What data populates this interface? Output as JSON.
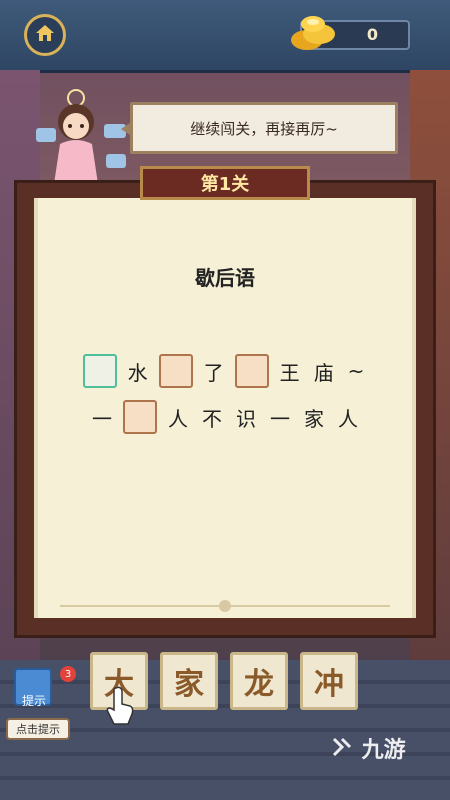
{
  "topbar": {
    "coin_count": "0",
    "home_icon": "home-icon",
    "coin_icon": "gold-ingot-icon"
  },
  "scene": {
    "speech_text": "继续闯关，再接再厉~",
    "level_label": "第1关"
  },
  "puzzle": {
    "title": "歇后语",
    "line1": [
      "水",
      "了",
      "王",
      "庙",
      "~"
    ],
    "line2": [
      "一",
      "人",
      "不",
      "识",
      "一",
      "家",
      "人"
    ]
  },
  "choices": [
    "大",
    "家",
    "龙",
    "冲"
  ],
  "hint": {
    "badge": "3",
    "label": "提示",
    "button": "点击提示"
  },
  "watermark": "九游",
  "colors": {
    "active_slot_border": "#4dbf9b",
    "slot_border": "#b0744c",
    "banner_bg": "#6b2a22",
    "banner_text": "#ffe7a4"
  }
}
